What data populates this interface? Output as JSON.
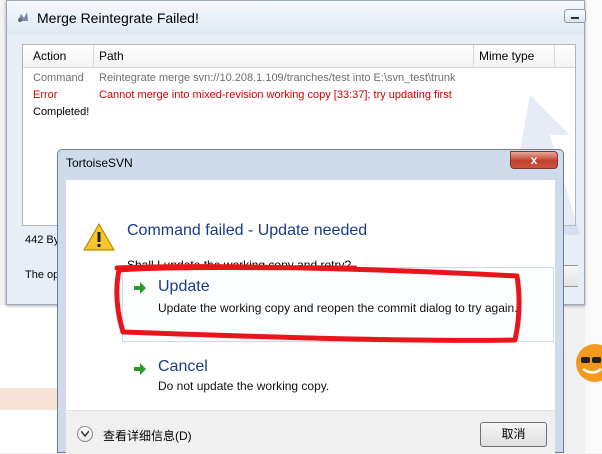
{
  "merge_window": {
    "title": "Merge Reintegrate Failed!",
    "columns": [
      "Action",
      "Path",
      "Mime type"
    ],
    "rows": [
      {
        "action": "Command",
        "path": "Reintegrate merge svn://10.208.1.109/tranches/test into E:\\svn_test\\trunk",
        "color": "#6e6e6e"
      },
      {
        "action": "Error",
        "path": "Cannot merge into mixed-revision working copy [33:37]; try updating first",
        "color": "#d10000"
      },
      {
        "action": "Completed!",
        "path": "",
        "color": "#000000"
      }
    ],
    "size_text": "442 By",
    "operation_text": "The op"
  },
  "dialog": {
    "title": "TortoiseSVN",
    "close_label": "x",
    "main_instruction": "Command failed - Update needed",
    "content": "Shall I update the working copy and retry?",
    "commands": [
      {
        "title": "Update",
        "description": "Update the working copy and reopen the commit dialog to try again."
      },
      {
        "title": "Cancel",
        "description": "Do not update the working copy."
      }
    ],
    "expand_label": "查看详细信息(D)",
    "cancel_button": "取消"
  },
  "colors": {
    "instruction_blue": "#1a3a8c",
    "error_red": "#d10000",
    "scribble_red": "#e8151b",
    "arrow_green": "#2a9a2a"
  },
  "icons": [
    "warning-icon",
    "arrow-right-icon",
    "chevron-down-icon",
    "app-icon"
  ]
}
